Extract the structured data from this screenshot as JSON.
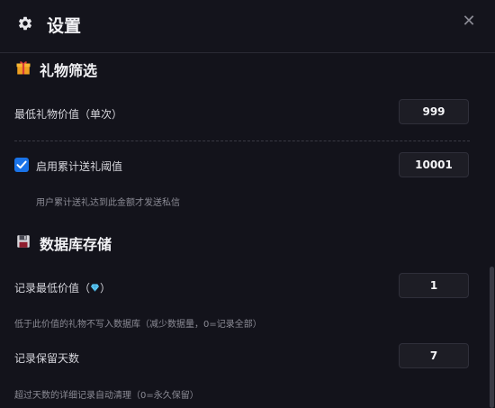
{
  "header": {
    "title": "设置",
    "settings_icon": "gear-icon",
    "close_icon": "close-icon",
    "close_glyph": "✕"
  },
  "gift_section": {
    "icon": "gift-icon",
    "title": "礼物筛选",
    "min_gift_label": "最低礼物价值（单次）",
    "min_gift_value": "999",
    "cumulative_checked": true,
    "cumulative_label": "启用累计送礼阈值",
    "cumulative_value": "10001",
    "cumulative_hint": "用户累计送礼达到此金额才发送私信"
  },
  "db_section": {
    "icon": "floppy-disk-icon",
    "title": "数据库存储",
    "record_min_label_prefix": "记录最低价值（",
    "record_min_label_suffix": "）",
    "record_min_icon": "diamond-icon",
    "record_min_value": "1",
    "record_min_hint": "低于此价值的礼物不写入数据库（减少数据量，0=记录全部）",
    "retention_label": "记录保留天数",
    "retention_value": "7",
    "retention_hint": "超过天数的详细记录自动清理（0=永久保留）"
  },
  "colors": {
    "background": "#13131b",
    "accent": "#1a73e8",
    "input_bg": "#1d1d25"
  }
}
